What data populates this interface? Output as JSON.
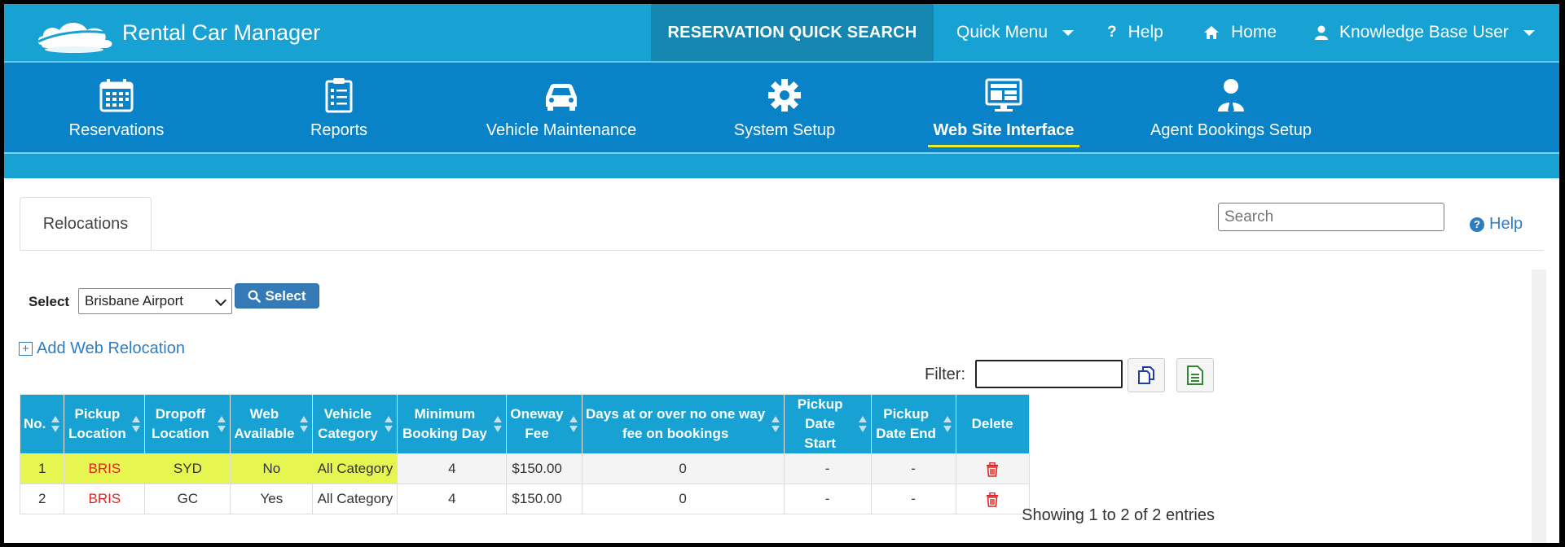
{
  "app": {
    "title": "Rental Car Manager",
    "quick_search": "RESERVATION QUICK SEARCH",
    "quick_menu": "Quick Menu",
    "help": "Help",
    "home": "Home",
    "user": "Knowledge Base User"
  },
  "nav": {
    "items": [
      {
        "label": "Reservations",
        "icon": "calendar-icon"
      },
      {
        "label": "Reports",
        "icon": "clipboard-icon"
      },
      {
        "label": "Vehicle Maintenance",
        "icon": "car-icon"
      },
      {
        "label": "System Setup",
        "icon": "gear-icon"
      },
      {
        "label": "Web Site Interface",
        "icon": "monitor-icon",
        "active": true
      },
      {
        "label": "Agent Bookings Setup",
        "icon": "agent-icon"
      }
    ]
  },
  "page": {
    "tab": "Relocations",
    "search_placeholder": "Search",
    "help": "Help",
    "select_label": "Select",
    "select_value": "Brisbane Airport",
    "select_button": "Select",
    "add_link": "Add Web Relocation",
    "filter_label": "Filter:",
    "filter_value": "",
    "showing": "Showing 1 to 2 of 2 entries"
  },
  "table": {
    "headers": [
      "No.",
      "Pickup Location",
      "Dropoff Location",
      "Web Available",
      "Vehicle Category",
      "Minimum Booking Day",
      "Oneway Fee",
      "Days at or over no one way fee on bookings",
      "Pickup Date Start",
      "Pickup Date End",
      "Delete"
    ],
    "rows": [
      [
        "1",
        "BRIS",
        "SYD",
        "No",
        "All Category",
        "4",
        "$150.00",
        "0",
        "-",
        "-"
      ],
      [
        "2",
        "BRIS",
        "GC",
        "Yes",
        "All Category",
        "4",
        "$150.00",
        "0",
        "-",
        "-"
      ]
    ]
  },
  "colors": {
    "header_bar": "#18a1d3",
    "nav_bar": "#0a82c8",
    "highlight": "#e6f54f",
    "link": "#2f7dc1",
    "location_text": "#e02424"
  }
}
